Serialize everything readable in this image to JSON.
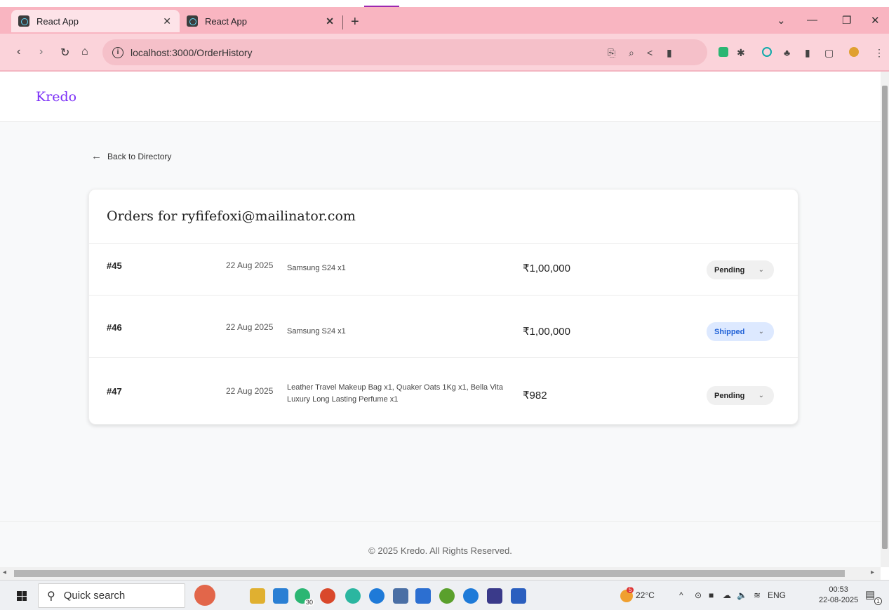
{
  "browser": {
    "tabs": [
      {
        "label": "React App",
        "active": true
      },
      {
        "label": "React App",
        "active": false
      }
    ],
    "new_tab": "+",
    "address": "localhost:3000/OrderHistory"
  },
  "app": {
    "brand": "Kredo",
    "back_link": "Back to Directory",
    "orders_title": "Orders for ryfifefoxi@mailinator.com",
    "orders": [
      {
        "id": "#45",
        "date": "22 Aug 2025",
        "items": "Samsung S24 x1",
        "amount": "₹1,00,000",
        "status": "Pending"
      },
      {
        "id": "#46",
        "date": "22 Aug 2025",
        "items": "Samsung S24 x1",
        "amount": "₹1,00,000",
        "status": "Shipped"
      },
      {
        "id": "#47",
        "date": "22 Aug 2025",
        "items": "Leather Travel Makeup Bag x1, Quaker Oats 1Kg x1, Bella Vita Luxury Long Lasting Perfume x1",
        "amount": "₹982",
        "status": "Pending"
      }
    ],
    "footer": "© 2025 Kredo. All Rights Reserved."
  },
  "taskbar": {
    "search_placeholder": "Quick search",
    "weather": "22°C",
    "lang": "ENG",
    "time": "00:53",
    "date": "22-08-2025",
    "whatsapp_badge": "30",
    "weather_badge": "5",
    "notif_count": "1"
  },
  "colors": {
    "tab_bar": "#f9b5c1",
    "brand": "#7b2ff7",
    "shipped_bg": "#dde9ff",
    "shipped_text": "#1d5fd6"
  }
}
